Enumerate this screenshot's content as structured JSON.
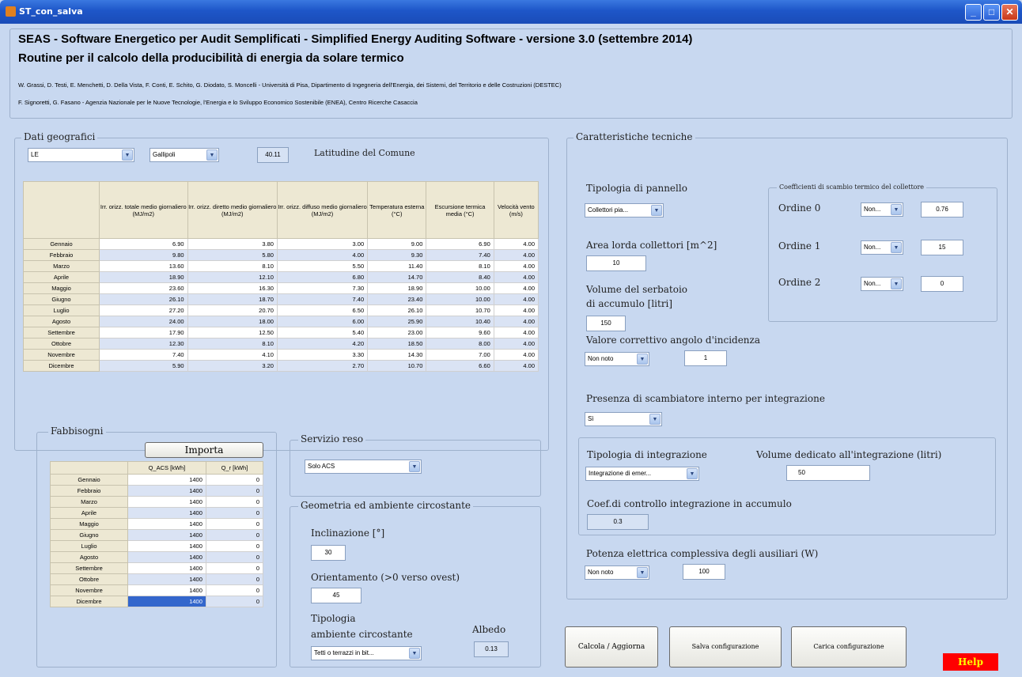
{
  "window": {
    "title": "ST_con_salva"
  },
  "header": {
    "title": "SEAS - Software Energetico per Audit Semplificati - Simplified Energy Auditing Software - versione 3.0 (settembre 2014)",
    "subtitle": "Routine per il calcolo della producibilità di energia da solare termico",
    "authors1": "W. Grassi, D. Testi, E. Menchetti, D. Della Vista, F. Conti, E. Schito, G. Diodato, S. Moncelli - Università di Pisa, Dipartimento di Ingegneria dell'Energia, dei Sistemi, del Territorio e delle Costruzioni (DESTEC)",
    "authors2": "F. Signoretti, G. Fasano - Agenzia Nazionale per le Nuove Tecnologie, l'Energia e lo Sviluppo Economico Sostenibile (ENEA), Centro Ricerche Casaccia"
  },
  "geo": {
    "title": "Dati geografici",
    "province": "LE",
    "comune": "Gallipoli",
    "latitude": "40.11",
    "latitude_label": "Latitudine del Comune",
    "columns": [
      "Irr. orizz. totale medio giornaliero (MJ/m2)",
      "Irr. orizz. diretto medio giornaliero (MJ/m2)",
      "Irr. orizz. diffuso medio giornaliero (MJ/m2)",
      "Temperatura esterna (°C)",
      "Escursione termica media (°C)",
      "Velocità vento (m/s)"
    ],
    "rows": [
      {
        "m": "Gennaio",
        "v": [
          "6.90",
          "3.80",
          "3.00",
          "9.00",
          "6.90",
          "4.00"
        ]
      },
      {
        "m": "Febbraio",
        "v": [
          "9.80",
          "5.80",
          "4.00",
          "9.30",
          "7.40",
          "4.00"
        ]
      },
      {
        "m": "Marzo",
        "v": [
          "13.60",
          "8.10",
          "5.50",
          "11.40",
          "8.10",
          "4.00"
        ]
      },
      {
        "m": "Aprile",
        "v": [
          "18.90",
          "12.10",
          "6.80",
          "14.70",
          "8.40",
          "4.00"
        ]
      },
      {
        "m": "Maggio",
        "v": [
          "23.60",
          "16.30",
          "7.30",
          "18.90",
          "10.00",
          "4.00"
        ]
      },
      {
        "m": "Giugno",
        "v": [
          "26.10",
          "18.70",
          "7.40",
          "23.40",
          "10.00",
          "4.00"
        ]
      },
      {
        "m": "Luglio",
        "v": [
          "27.20",
          "20.70",
          "6.50",
          "26.10",
          "10.70",
          "4.00"
        ]
      },
      {
        "m": "Agosto",
        "v": [
          "24.00",
          "18.00",
          "6.00",
          "25.90",
          "10.40",
          "4.00"
        ]
      },
      {
        "m": "Settembre",
        "v": [
          "17.90",
          "12.50",
          "5.40",
          "23.00",
          "9.60",
          "4.00"
        ]
      },
      {
        "m": "Ottobre",
        "v": [
          "12.30",
          "8.10",
          "4.20",
          "18.50",
          "8.00",
          "4.00"
        ]
      },
      {
        "m": "Novembre",
        "v": [
          "7.40",
          "4.10",
          "3.30",
          "14.30",
          "7.00",
          "4.00"
        ]
      },
      {
        "m": "Dicembre",
        "v": [
          "5.90",
          "3.20",
          "2.70",
          "10.70",
          "6.60",
          "4.00"
        ]
      }
    ]
  },
  "needs": {
    "title": "Fabbisogni",
    "import_label": "Importa",
    "columns": [
      "Q_ACS [kWh]",
      "Q_r [kWh]"
    ],
    "rows": [
      {
        "m": "Gennaio",
        "v": [
          "1400",
          "0"
        ]
      },
      {
        "m": "Febbraio",
        "v": [
          "1400",
          "0"
        ]
      },
      {
        "m": "Marzo",
        "v": [
          "1400",
          "0"
        ]
      },
      {
        "m": "Aprile",
        "v": [
          "1400",
          "0"
        ]
      },
      {
        "m": "Maggio",
        "v": [
          "1400",
          "0"
        ]
      },
      {
        "m": "Giugno",
        "v": [
          "1400",
          "0"
        ]
      },
      {
        "m": "Luglio",
        "v": [
          "1400",
          "0"
        ]
      },
      {
        "m": "Agosto",
        "v": [
          "1400",
          "0"
        ]
      },
      {
        "m": "Settembre",
        "v": [
          "1400",
          "0"
        ]
      },
      {
        "m": "Ottobre",
        "v": [
          "1400",
          "0"
        ]
      },
      {
        "m": "Novembre",
        "v": [
          "1400",
          "0"
        ]
      },
      {
        "m": "Dicembre",
        "v": [
          "1400",
          "0"
        ]
      }
    ]
  },
  "service": {
    "title": "Servizio reso",
    "value": "Solo ACS"
  },
  "geometry": {
    "title": "Geometria ed ambiente circostante",
    "incl_label": "Inclinazione [°]",
    "incl_value": "30",
    "orient_label": "Orientamento (>0 verso ovest)",
    "orient_value": "45",
    "env_label1": "Tipologia",
    "env_label2": "ambiente circostante",
    "env_value": "Tetti o terrazzi in bit...",
    "albedo_label": "Albedo",
    "albedo_value": "0.13"
  },
  "tech": {
    "title": "Caratteristiche tecniche",
    "panel_label": "Tipologia di pannello",
    "panel_value": "Collettori pia...",
    "area_label": "Area lorda collettori [m^2]",
    "area_value": "10",
    "vol_label1": "Volume del serbatoio",
    "vol_label2": "di accumulo [litri]",
    "vol_value": "150",
    "iam_label": "Valore correttivo angolo d'incidenza",
    "iam_select": "Non noto",
    "iam_value": "1",
    "coef_title": "Coefficienti di scambio termico del collettore",
    "coef": [
      {
        "label": "Ordine 0",
        "sel": "Non...",
        "value": "0.76"
      },
      {
        "label": "Ordine 1",
        "sel": "Non...",
        "value": "15"
      },
      {
        "label": "Ordine 2",
        "sel": "Non...",
        "value": "0"
      }
    ],
    "exch_label": "Presenza di scambiatore interno per integrazione",
    "exch_value": "Sì",
    "integ_label": "Tipologia di integrazione",
    "integ_value": "Integrazione di emer...",
    "integ_vol_label": "Volume dedicato all'integrazione (litri)",
    "integ_vol_value": "50",
    "ctrl_label": "Coef.di controllo integrazione in accumulo",
    "ctrl_value": "0.3",
    "aux_label": "Potenza elettrica complessiva degli ausiliari (W)",
    "aux_select": "Non noto",
    "aux_value": "100"
  },
  "buttons": {
    "calc": "Calcola / Aggiorna",
    "save": "Salva configurazione",
    "load": "Carica configurazione",
    "help": "Help"
  }
}
